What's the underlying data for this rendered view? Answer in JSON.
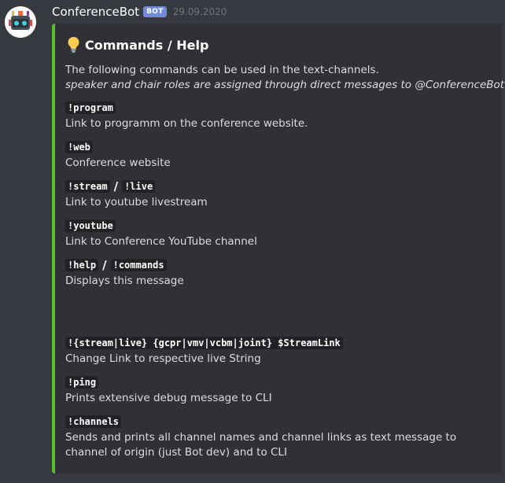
{
  "message": {
    "username": "ConferenceBot",
    "bot_tag": "BOT",
    "timestamp": "29.09.2020",
    "avatar_icon": "robot-avatar-icon"
  },
  "embed": {
    "accent_color": "#56c02b",
    "title_icon": "lightbulb-icon",
    "title": "Commands / Help",
    "description_line1": "The following commands can be used in the text-channels.",
    "description_line2": "speaker and chair roles are assigned through direct messages to @ConferenceBot",
    "fields": [
      {
        "cmd1": "!program",
        "value": "Link to programm on the conference website."
      },
      {
        "cmd1": "!web",
        "value": "Conference website"
      },
      {
        "cmd1": "!stream",
        "sep": "/",
        "cmd2": "!live",
        "value": "Link to youtube livestream"
      },
      {
        "cmd1": "!youtube",
        "value": "Link to Conference YouTube channel"
      },
      {
        "cmd1": "!help",
        "sep": "/",
        "cmd2": "!commands",
        "value": "Displays this message"
      },
      {
        "cmd1": "!{stream|live} {gcpr|vmv|vcbm|joint} $StreamLink",
        "value": "Change Link to respective live String"
      },
      {
        "cmd1": "!ping",
        "value": "Prints extensive debug message to CLI"
      },
      {
        "cmd1": "!channels",
        "value": "Sends and prints all channel names and channel links as text message to channel of origin (just Bot dev) and to CLI"
      }
    ]
  },
  "colors": {
    "background": "#36393f",
    "embed_background": "#2f3136",
    "bot_tag": "#7289da",
    "timestamp": "#72767d"
  }
}
